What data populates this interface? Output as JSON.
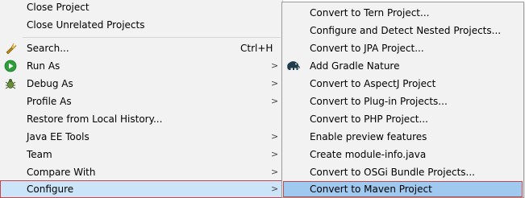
{
  "main_menu": {
    "items": [
      {
        "label": "Close Project",
        "submenu": false
      },
      {
        "label": "Close Unrelated Projects",
        "submenu": false
      },
      {
        "label": "Search...",
        "shortcut": "Ctrl+H",
        "icon": "search-flashlight-icon",
        "submenu": false
      },
      {
        "label": "Run As",
        "icon": "run-icon",
        "submenu": true
      },
      {
        "label": "Debug As",
        "icon": "debug-bug-icon",
        "submenu": true
      },
      {
        "label": "Profile As",
        "submenu": true
      },
      {
        "label": "Restore from Local History...",
        "submenu": false
      },
      {
        "label": "Java EE Tools",
        "submenu": true
      },
      {
        "label": "Team",
        "submenu": true
      },
      {
        "label": "Compare With",
        "submenu": true
      },
      {
        "label": "Configure",
        "submenu": true,
        "selected": true
      }
    ]
  },
  "sub_menu": {
    "items": [
      {
        "label": "Convert to Tern Project..."
      },
      {
        "label": "Configure and Detect Nested Projects..."
      },
      {
        "label": "Convert to JPA Project..."
      },
      {
        "label": "Add Gradle Nature",
        "icon": "gradle-elephant-icon"
      },
      {
        "label": "Convert to AspectJ Project"
      },
      {
        "label": "Convert to Plug-in Projects..."
      },
      {
        "label": "Convert to PHP Project..."
      },
      {
        "label": "Enable preview features"
      },
      {
        "label": "Create module-info.java"
      },
      {
        "label": "Convert to OSGi Bundle Projects..."
      },
      {
        "label": "Convert to Maven Project",
        "selected": true
      }
    ]
  },
  "colors": {
    "menu_background": "#f2f2f2",
    "selection_background": "#cce4f7",
    "submenu_selection_background": "#9fc9ef",
    "selection_border": "#c7464b",
    "run_icon_green": "#2e9e3a",
    "gradle_icon": "#1f3d4c"
  },
  "glyphs": {
    "submenu_arrow": ">"
  }
}
